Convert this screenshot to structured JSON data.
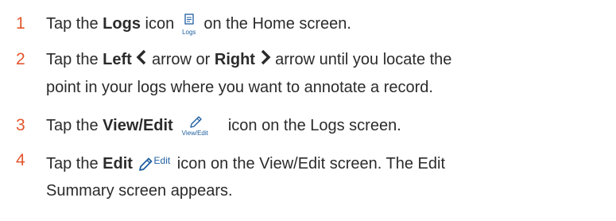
{
  "steps": [
    {
      "number": "1",
      "pre": "Tap the ",
      "bold": "Logs",
      "post1": " icon ",
      "icon_label": "Logs",
      "icon": "logs-icon",
      "post2": " on the Home screen."
    },
    {
      "number": "2",
      "pre": "Tap the ",
      "bold1": "Left",
      "mid1": " arrow or ",
      "bold2": "Right",
      "mid2": " arrow until you locate the",
      "line2": "point in your logs where you want to annotate a record.",
      "icons": [
        "chevron-left-icon",
        "chevron-right-icon"
      ]
    },
    {
      "number": "3",
      "pre": "Tap the ",
      "bold": "View/Edit",
      "icon_label": "View/Edit",
      "icon": "pencil-icon",
      "post": " icon on the Logs screen."
    },
    {
      "number": "4",
      "pre": "Tap the ",
      "bold": "Edit",
      "icon_label": "Edit",
      "icon": "pencil-icon",
      "post": " icon on the View/Edit screen. The Edit",
      "line2": "Summary screen appears."
    }
  ],
  "colors": {
    "number": "#e4572e",
    "text": "#2b2b2b",
    "icon": "#1f5fa0"
  }
}
